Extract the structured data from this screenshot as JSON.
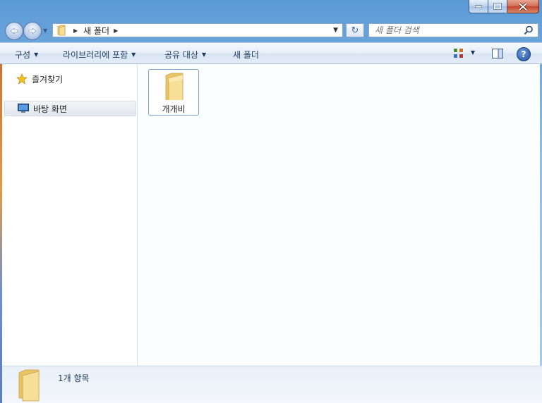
{
  "window": {
    "caption_buttons": [
      "minimize",
      "maximize",
      "close"
    ]
  },
  "address_bar": {
    "crumbs": [
      "새 폴더"
    ],
    "search_placeholder": "새 폴더 검색"
  },
  "command_bar": {
    "organize": "구성",
    "include_in_library": "라이브러리에 포함",
    "share_with": "공유 대상",
    "new_folder": "새 폴더"
  },
  "nav_pane": {
    "favorites": "즐겨찾기",
    "desktop": "바탕 화면"
  },
  "content": {
    "items": [
      {
        "name": "개개비",
        "type": "folder"
      }
    ]
  },
  "details_pane": {
    "item_count": "1개 항목"
  },
  "colors": {
    "accent": "#1e395b",
    "selection_border": "#7da2ce",
    "folder_yellow": "#f3d37a"
  }
}
